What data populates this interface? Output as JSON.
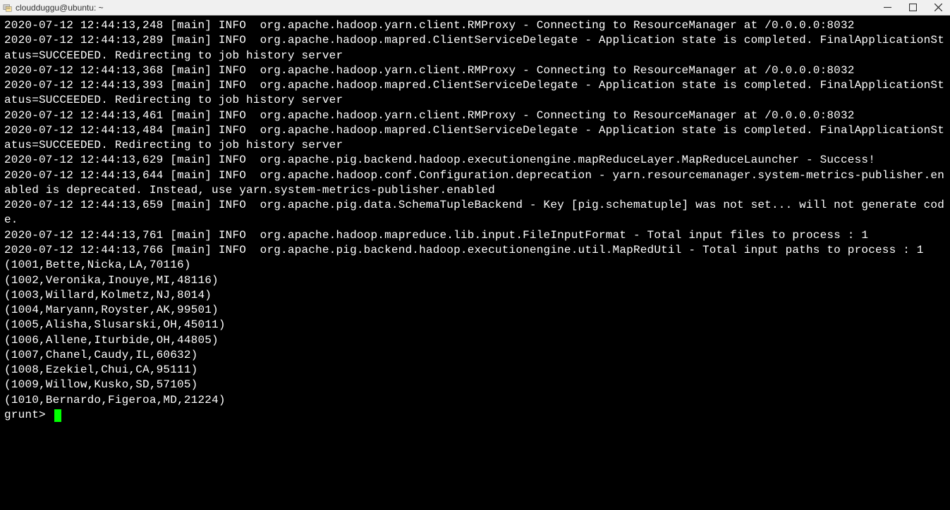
{
  "window": {
    "title": "cloudduggu@ubuntu: ~"
  },
  "log_lines": [
    "2020-07-12 12:44:13,248 [main] INFO  org.apache.hadoop.yarn.client.RMProxy - Connecting to ResourceManager at /0.0.0.0:8032",
    "2020-07-12 12:44:13,289 [main] INFO  org.apache.hadoop.mapred.ClientServiceDelegate - Application state is completed. FinalApplicationStatus=SUCCEEDED. Redirecting to job history server",
    "2020-07-12 12:44:13,368 [main] INFO  org.apache.hadoop.yarn.client.RMProxy - Connecting to ResourceManager at /0.0.0.0:8032",
    "2020-07-12 12:44:13,393 [main] INFO  org.apache.hadoop.mapred.ClientServiceDelegate - Application state is completed. FinalApplicationStatus=SUCCEEDED. Redirecting to job history server",
    "2020-07-12 12:44:13,461 [main] INFO  org.apache.hadoop.yarn.client.RMProxy - Connecting to ResourceManager at /0.0.0.0:8032",
    "2020-07-12 12:44:13,484 [main] INFO  org.apache.hadoop.mapred.ClientServiceDelegate - Application state is completed. FinalApplicationStatus=SUCCEEDED. Redirecting to job history server",
    "2020-07-12 12:44:13,629 [main] INFO  org.apache.pig.backend.hadoop.executionengine.mapReduceLayer.MapReduceLauncher - Success!",
    "2020-07-12 12:44:13,644 [main] INFO  org.apache.hadoop.conf.Configuration.deprecation - yarn.resourcemanager.system-metrics-publisher.enabled is deprecated. Instead, use yarn.system-metrics-publisher.enabled",
    "2020-07-12 12:44:13,659 [main] INFO  org.apache.pig.data.SchemaTupleBackend - Key [pig.schematuple] was not set... will not generate code.",
    "2020-07-12 12:44:13,761 [main] INFO  org.apache.hadoop.mapreduce.lib.input.FileInputFormat - Total input files to process : 1",
    "2020-07-12 12:44:13,766 [main] INFO  org.apache.pig.backend.hadoop.executionengine.util.MapRedUtil - Total input paths to process : 1",
    "(1001,Bette,Nicka,LA,70116)",
    "(1002,Veronika,Inouye,MI,48116)",
    "(1003,Willard,Kolmetz,NJ,8014)",
    "(1004,Maryann,Royster,AK,99501)",
    "(1005,Alisha,Slusarski,OH,45011)",
    "(1006,Allene,Iturbide,OH,44805)",
    "(1007,Chanel,Caudy,IL,60632)",
    "(1008,Ezekiel,Chui,CA,95111)",
    "(1009,Willow,Kusko,SD,57105)",
    "(1010,Bernardo,Figeroa,MD,21224)"
  ],
  "prompt": "grunt> "
}
